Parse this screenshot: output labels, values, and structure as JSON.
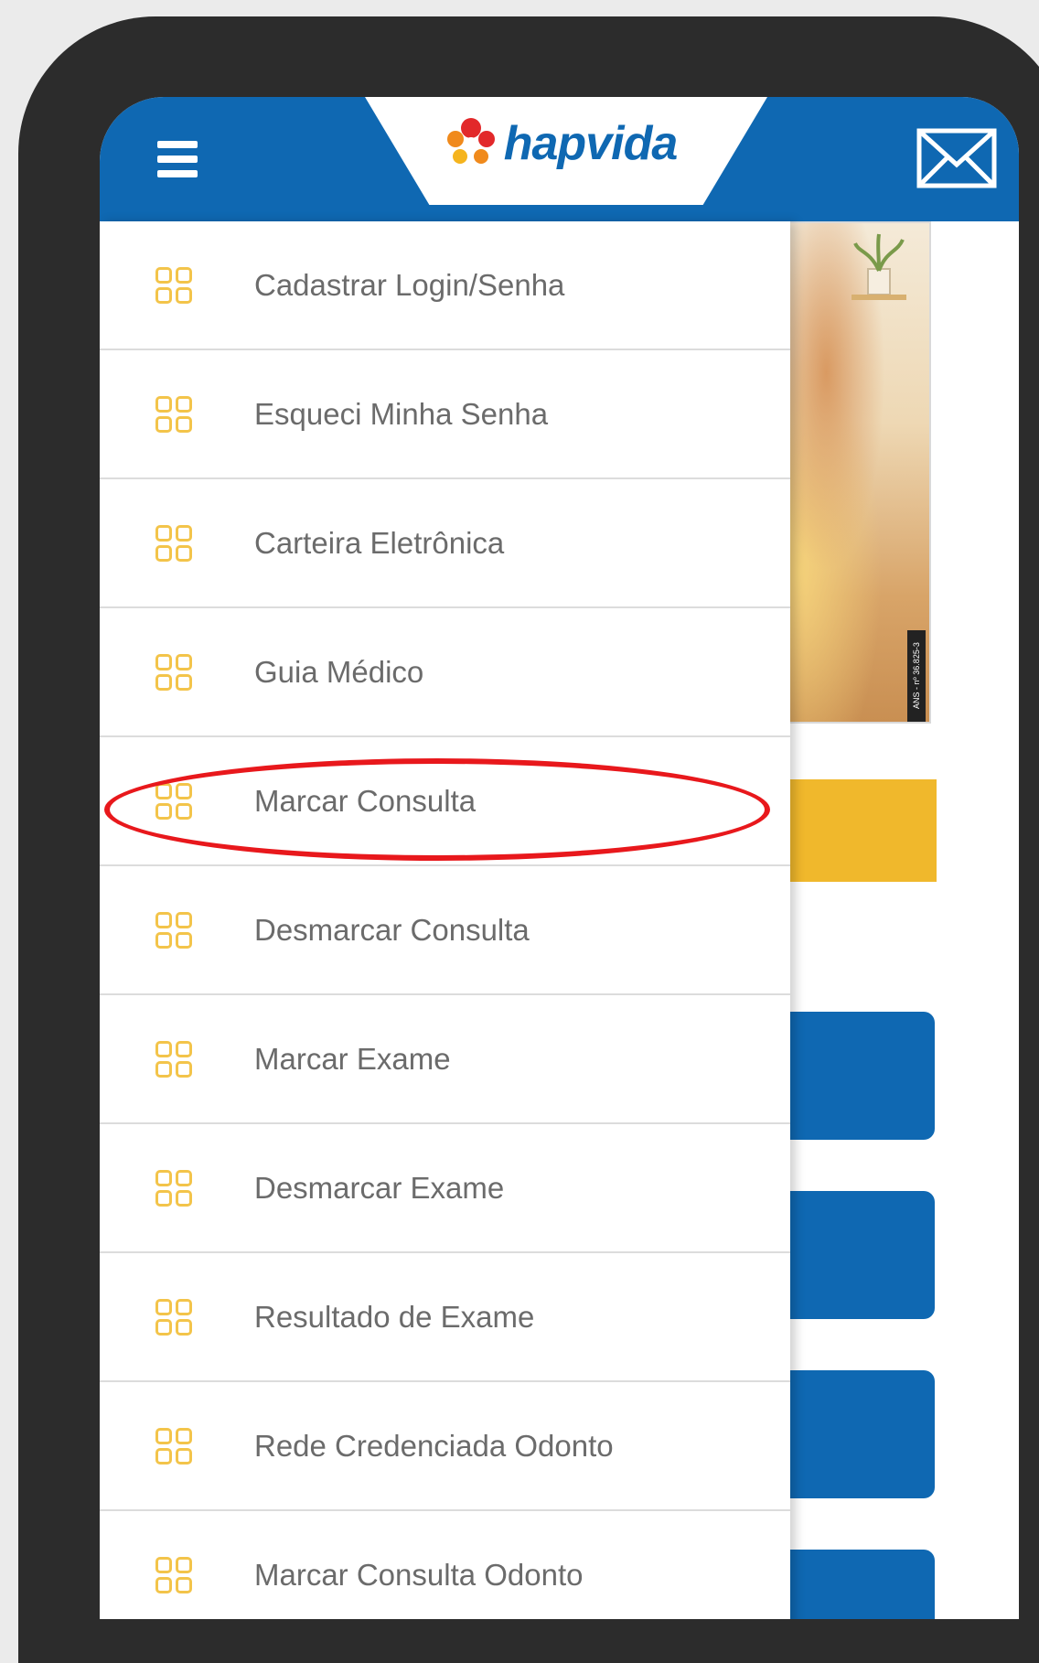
{
  "header": {
    "menu_icon": "hamburger-icon",
    "logo_text": "hapvida",
    "logo_icon": "flower-icon",
    "mail_icon": "envelope-icon",
    "color": "#0f68b2"
  },
  "banner": {
    "ans_text": "ANS - nº 36.825-3"
  },
  "menu": {
    "icon": "grid-icon",
    "icon_color": "#f3c44a",
    "items": [
      {
        "label": "Cadastrar Login/Senha"
      },
      {
        "label": "Esqueci Minha Senha"
      },
      {
        "label": "Carteira Eletrônica"
      },
      {
        "label": "Guia Médico"
      },
      {
        "label": "Marcar Consulta",
        "highlighted": true
      },
      {
        "label": "Desmarcar Consulta"
      },
      {
        "label": "Marcar Exame"
      },
      {
        "label": "Desmarcar Exame"
      },
      {
        "label": "Resultado de Exame"
      },
      {
        "label": "Rede Credenciada Odonto"
      },
      {
        "label": "Marcar Consulta Odonto"
      }
    ]
  },
  "annotation": {
    "highlight_color": "#e8181c"
  }
}
